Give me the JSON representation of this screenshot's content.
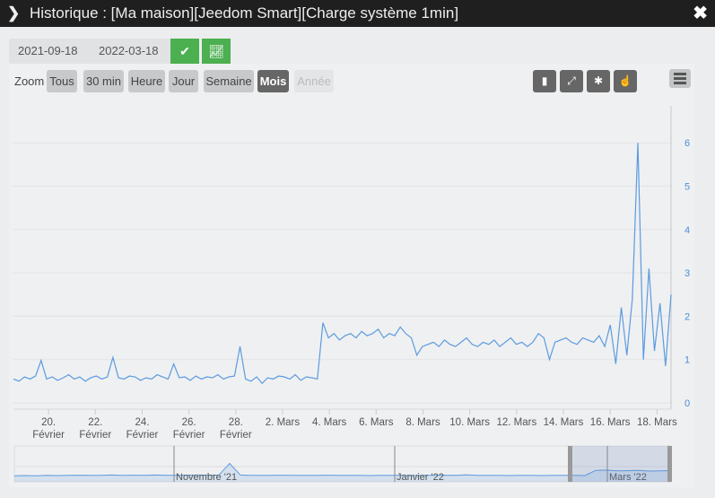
{
  "window": {
    "title": "Historique : [Ma maison][Jeedom Smart][Charge système 1min]",
    "close_icon": "close-icon"
  },
  "dates": {
    "start": "2021-09-18",
    "end": "2022-03-18"
  },
  "zoom": {
    "label": "Zoom",
    "buttons": [
      "Tous",
      "30 min",
      "Heure",
      "Jour",
      "Semaine",
      "Mois",
      "Année"
    ],
    "active": "Mois",
    "disabled": "Année"
  },
  "tools": [
    "column-icon",
    "compress-icon",
    "snowflake-icon",
    "hand-pointer-icon"
  ],
  "colors": {
    "series": "#5b9be0",
    "accent": "#4caf50",
    "title_bg": "#1f1f1f"
  },
  "chart_data": {
    "type": "line",
    "title": "Charge système 1min",
    "x_unit": "days since 2022-02-18",
    "x_range": [
      0.5,
      28.6
    ],
    "x_ticks": [
      {
        "day": 2,
        "label": [
          "20.",
          "Février"
        ]
      },
      {
        "day": 4,
        "label": [
          "22.",
          "Février"
        ]
      },
      {
        "day": 6,
        "label": [
          "24.",
          "Février"
        ]
      },
      {
        "day": 8,
        "label": [
          "26.",
          "Février"
        ]
      },
      {
        "day": 10,
        "label": [
          "28.",
          "Février"
        ]
      },
      {
        "day": 12,
        "label": [
          "2. Mars"
        ]
      },
      {
        "day": 14,
        "label": [
          "4. Mars"
        ]
      },
      {
        "day": 16,
        "label": [
          "6. Mars"
        ]
      },
      {
        "day": 18,
        "label": [
          "8. Mars"
        ]
      },
      {
        "day": 20,
        "label": [
          "10. Mars"
        ]
      },
      {
        "day": 22,
        "label": [
          "12. Mars"
        ]
      },
      {
        "day": 24,
        "label": [
          "14. Mars"
        ]
      },
      {
        "day": 26,
        "label": [
          "16. Mars"
        ]
      },
      {
        "day": 28,
        "label": [
          "18. Mars"
        ]
      }
    ],
    "y_ticks": [
      "0",
      "1",
      "2",
      "3",
      "4",
      "5",
      "6"
    ],
    "ylim": [
      0,
      6.6
    ],
    "values": [
      0.55,
      0.5,
      0.6,
      0.55,
      0.62,
      0.98,
      0.55,
      0.6,
      0.52,
      0.58,
      0.65,
      0.55,
      0.6,
      0.5,
      0.58,
      0.62,
      0.55,
      0.6,
      1.05,
      0.58,
      0.55,
      0.62,
      0.6,
      0.52,
      0.58,
      0.55,
      0.65,
      0.6,
      0.55,
      0.9,
      0.58,
      0.6,
      0.52,
      0.62,
      0.55,
      0.6,
      0.58,
      0.65,
      0.55,
      0.6,
      0.62,
      1.3,
      0.55,
      0.5,
      0.6,
      0.45,
      0.58,
      0.55,
      0.62,
      0.6,
      0.55,
      0.65,
      0.52,
      0.6,
      0.58,
      0.55,
      1.85,
      1.5,
      1.6,
      1.45,
      1.55,
      1.6,
      1.5,
      1.65,
      1.55,
      1.6,
      1.7,
      1.5,
      1.6,
      1.55,
      1.75,
      1.6,
      1.5,
      1.1,
      1.3,
      1.35,
      1.4,
      1.3,
      1.45,
      1.35,
      1.3,
      1.4,
      1.5,
      1.35,
      1.3,
      1.4,
      1.35,
      1.45,
      1.3,
      1.4,
      1.5,
      1.35,
      1.4,
      1.3,
      1.4,
      1.6,
      1.5,
      1.0,
      1.4,
      1.45,
      1.5,
      1.4,
      1.35,
      1.5,
      1.45,
      1.4,
      1.55,
      1.3,
      1.8,
      0.9,
      2.2,
      1.1,
      2.4,
      6.0,
      1.0,
      3.1,
      1.2,
      2.3,
      0.85,
      2.5
    ],
    "navigator": {
      "labels": [
        "Novembre '21",
        "Janvier '22",
        "Mars '22"
      ],
      "values": [
        0.5,
        0.55,
        0.5,
        0.6,
        0.55,
        0.6,
        0.62,
        0.58,
        0.6,
        0.65,
        0.6,
        0.62,
        0.6,
        0.65,
        0.62,
        0.6,
        0.62,
        0.65,
        0.62,
        0.65,
        3.0,
        0.65,
        0.6,
        0.58,
        0.6,
        0.62,
        0.6,
        0.58,
        0.6,
        0.62,
        0.6,
        0.58,
        0.6,
        0.55,
        0.6,
        0.58,
        0.6,
        0.55,
        0.6,
        0.58,
        0.62,
        0.6,
        0.7,
        0.6,
        0.58,
        0.6,
        0.55,
        0.6,
        0.58,
        0.55,
        0.6,
        0.58,
        0.6,
        0.55,
        1.6,
        1.65,
        1.5,
        1.55,
        1.6,
        1.45,
        1.5,
        1.55
      ]
    }
  }
}
